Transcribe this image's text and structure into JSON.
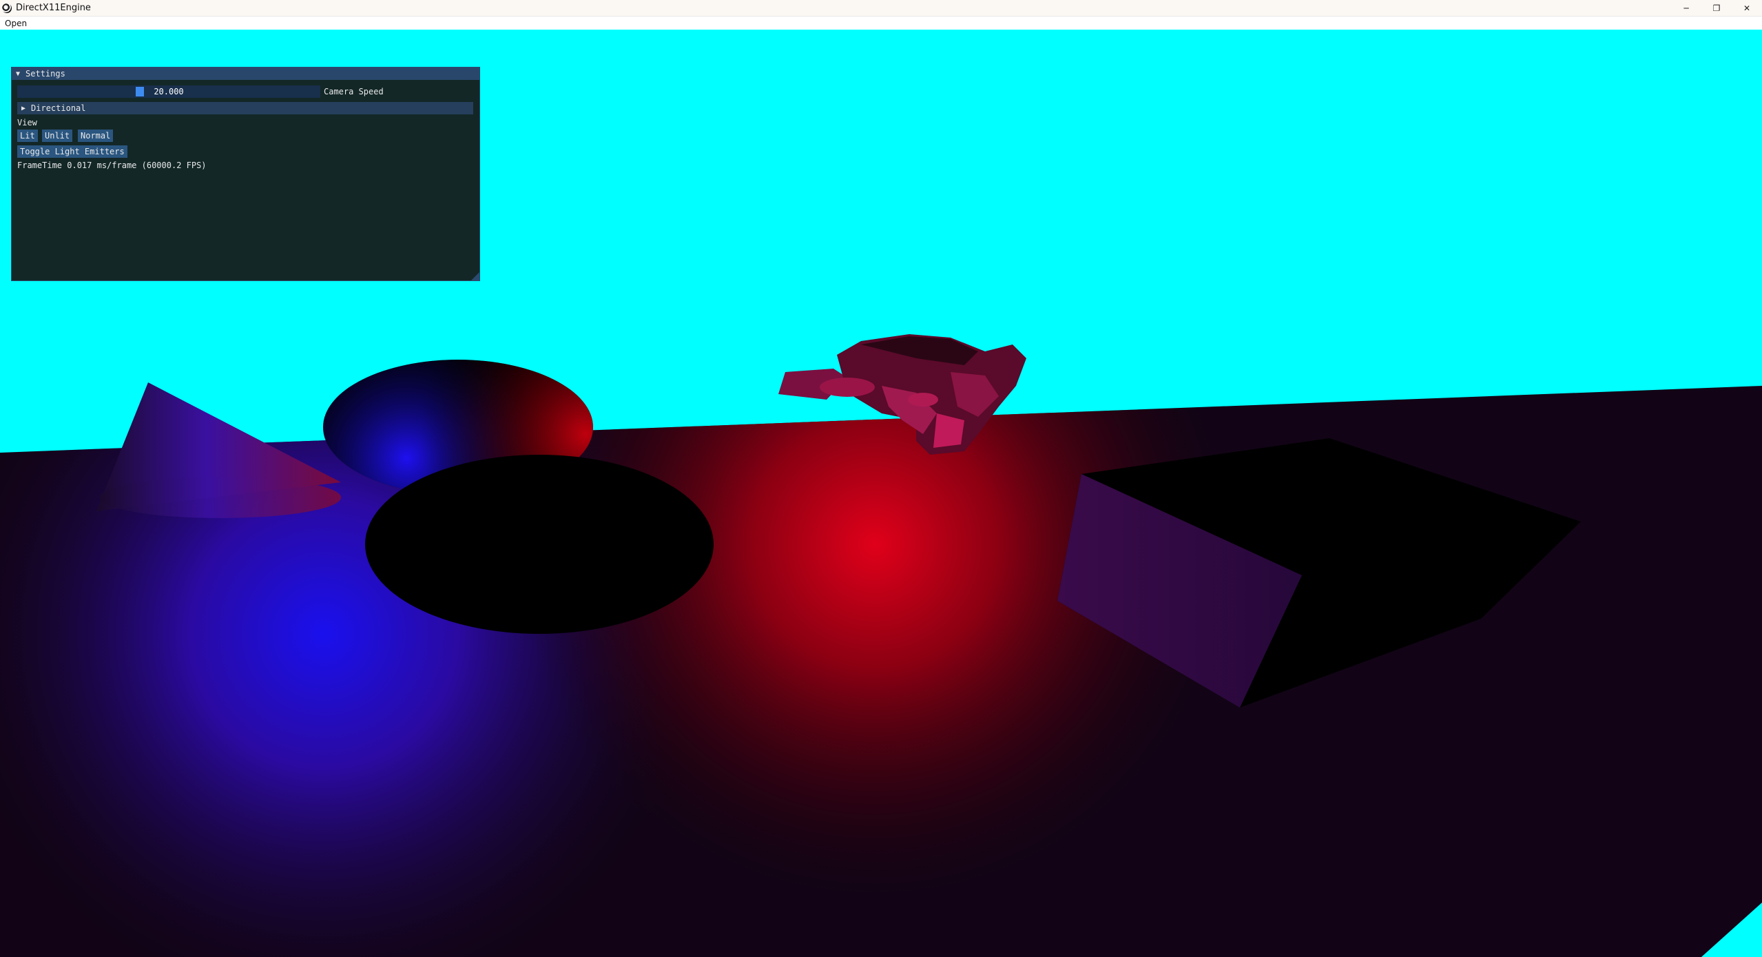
{
  "window": {
    "title": "DirectX11Engine",
    "controls": {
      "minimize": "─",
      "restore": "❐",
      "close": "✕"
    }
  },
  "menu": {
    "items": [
      "Open"
    ]
  },
  "settings_panel": {
    "title": "Settings",
    "camera_speed": {
      "value": "20.000",
      "label": "Camera Speed"
    },
    "directional": {
      "label": "Directional"
    },
    "view_label": "View",
    "view_buttons": [
      "Lit",
      "Unlit",
      "Normal"
    ],
    "toggle_light_emitters": "Toggle Light Emitters",
    "frametime": "FrameTime 0.017 ms/frame (60000.2 FPS)"
  },
  "scene": {
    "sky_color": "#00ffff",
    "objects": [
      "cone",
      "sphere",
      "hemisphere",
      "cube",
      "monkey-head",
      "ground-plane"
    ],
    "lights": [
      {
        "name": "blue-point-light",
        "color": "#1a10ee"
      },
      {
        "name": "red-point-light",
        "color": "#e0001a"
      }
    ]
  }
}
